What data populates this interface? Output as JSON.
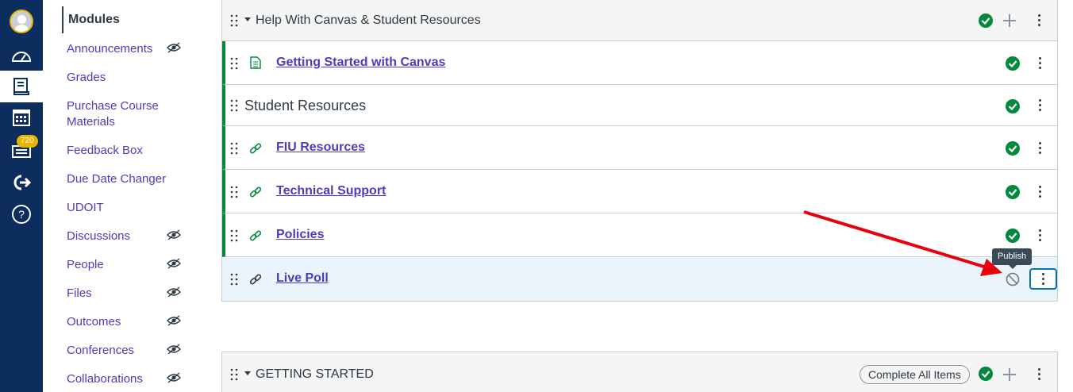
{
  "global_nav": {
    "items": [
      {
        "icon": "account-avatar-icon"
      },
      {
        "icon": "dashboard-icon"
      },
      {
        "icon": "courses-icon",
        "active": true
      },
      {
        "icon": "calendar-icon"
      },
      {
        "icon": "inbox-icon",
        "badge": "720"
      },
      {
        "icon": "commons-icon"
      },
      {
        "icon": "help-icon"
      }
    ],
    "colors": {
      "background": "#0c2d5e",
      "badge": "#e9b400"
    }
  },
  "course_nav": {
    "current": "Modules",
    "links": [
      {
        "label": "Announcements",
        "hidden": true
      },
      {
        "label": "Grades",
        "hidden": false
      },
      {
        "label": "Purchase Course Materials",
        "hidden": false
      },
      {
        "label": "Feedback Box",
        "hidden": false
      },
      {
        "label": "Due Date Changer",
        "hidden": false
      },
      {
        "label": "UDOIT",
        "hidden": false
      },
      {
        "label": "Discussions",
        "hidden": true
      },
      {
        "label": "People",
        "hidden": true
      },
      {
        "label": "Files",
        "hidden": true
      },
      {
        "label": "Outcomes",
        "hidden": true
      },
      {
        "label": "Conferences",
        "hidden": true
      },
      {
        "label": "Collaborations",
        "hidden": true
      }
    ]
  },
  "modules": [
    {
      "title": "Help With Canvas & Student Resources",
      "published": true,
      "items": [
        {
          "type": "page",
          "title": "Getting Started with Canvas",
          "published": true
        },
        {
          "type": "text-header",
          "title": "Student Resources",
          "published": true
        },
        {
          "type": "external-link",
          "title": "FIU Resources",
          "published": true
        },
        {
          "type": "external-link",
          "title": "Technical Support",
          "published": true
        },
        {
          "type": "external-link",
          "title": "Policies",
          "published": true
        },
        {
          "type": "external-link",
          "title": "Live Poll",
          "published": false
        }
      ]
    },
    {
      "title": "GETTING STARTED",
      "published": true,
      "complete_button": "Complete All Items"
    }
  ],
  "tooltip": "Publish",
  "colors": {
    "published": "#03893d",
    "link": "#4b3cbd",
    "annotation_arrow": "#e8000b"
  }
}
